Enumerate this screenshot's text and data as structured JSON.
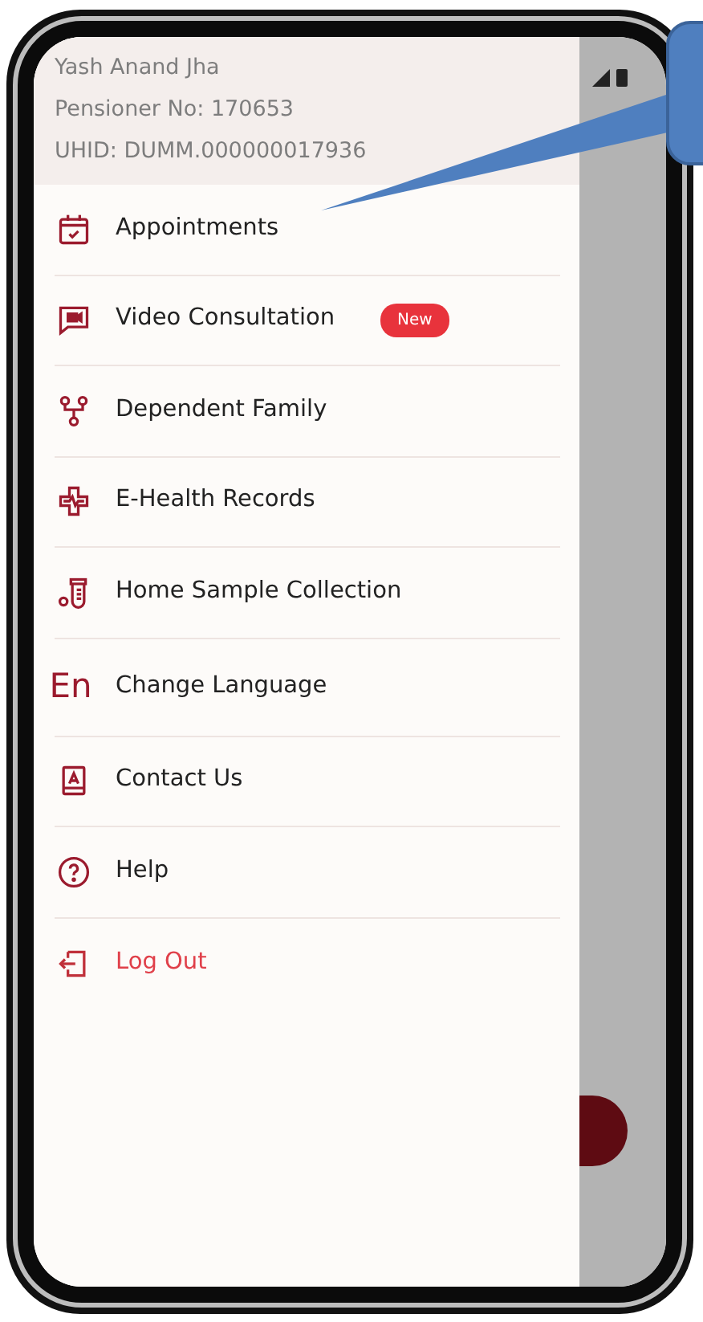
{
  "profile": {
    "name": "Yash Anand Jha",
    "pensioner_no": "Pensioner No: 170653",
    "uhid": "UHID: DUMM.000000017936"
  },
  "menu": [
    {
      "kind": "item",
      "label": "Appointments"
    },
    {
      "kind": "item",
      "label": "Video Consultation",
      "badge": "New"
    },
    {
      "kind": "item",
      "label": "Dependent Family"
    },
    {
      "kind": "item",
      "label": "E-Health Records"
    },
    {
      "kind": "item",
      "label": "Home Sample Collection"
    },
    {
      "kind": "language",
      "label": "Change Language",
      "icon_text": "En"
    },
    {
      "kind": "item",
      "label": "Contact Us"
    },
    {
      "kind": "item",
      "label": "Help"
    },
    {
      "kind": "logout",
      "label": "Log Out"
    }
  ]
}
